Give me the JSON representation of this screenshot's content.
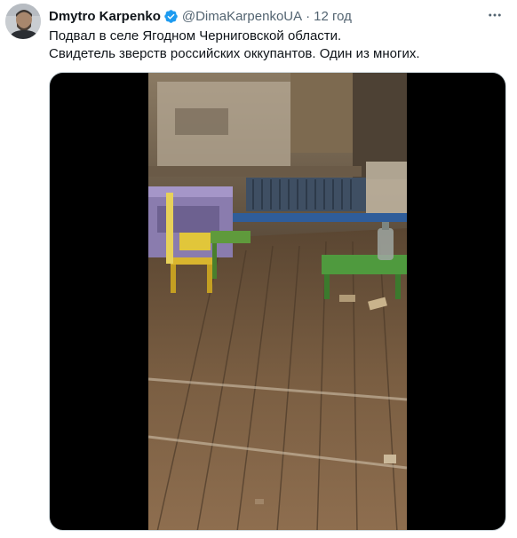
{
  "tweet": {
    "author_name": "Dmytro Karpenko",
    "handle": "@DimaKarpenkoUA",
    "separator": "·",
    "timestamp": "12 год",
    "text_lines": [
      "Подвал в селе Ягодном Черниговской области.",
      "Свидетель зверств российских оккупантов. Один из многих."
    ],
    "verified": true,
    "accent_color": "#1d9bf0"
  },
  "icons": {
    "verified": "verified-badge-icon",
    "more": "more-dots-icon"
  }
}
